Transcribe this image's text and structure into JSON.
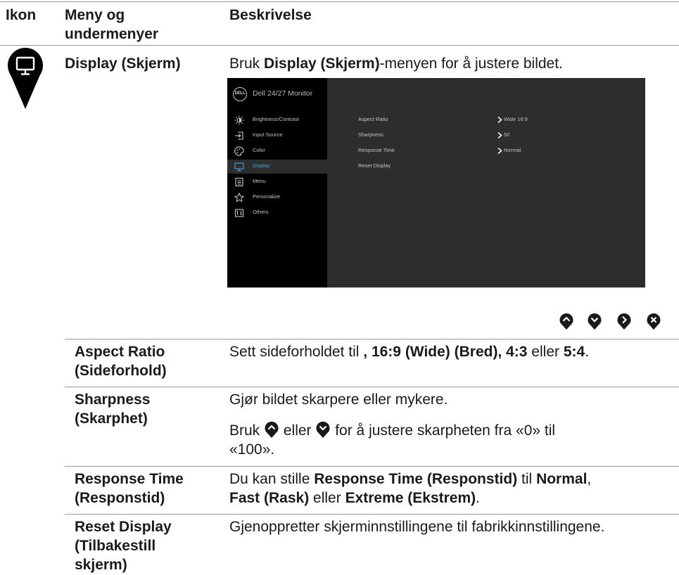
{
  "header": {
    "col_icon": "Ikon",
    "col_menu_line1": "Meny og",
    "col_menu_line2": "undermenyer",
    "col_desc": "Beskrivelse"
  },
  "display_section": {
    "icon": "monitor-icon",
    "menu_label": "Display (Skjerm)",
    "desc_prefix": "Bruk ",
    "desc_bold": "Display (Skjerm)",
    "desc_suffix": "-menyen for å justere bildet."
  },
  "osd": {
    "logo": "DELL",
    "title": "Dell 24/27 Monitor",
    "menu": [
      {
        "icon": "brightness-icon",
        "label": "Brightness/Contrast"
      },
      {
        "icon": "input-source-icon",
        "label": "Input Source"
      },
      {
        "icon": "color-icon",
        "label": "Color"
      },
      {
        "icon": "display-icon",
        "label": "Display",
        "selected": true
      },
      {
        "icon": "menu-icon",
        "label": "Menu"
      },
      {
        "icon": "personalize-star-icon",
        "label": "Personalize"
      },
      {
        "icon": "others-icon",
        "label": "Others"
      }
    ],
    "settings": [
      {
        "label": "Aspect Ratio",
        "value": "Wide 16:9",
        "has_submenu": true
      },
      {
        "label": "Sharpness",
        "value": "50",
        "has_submenu": true
      },
      {
        "label": "Response Time",
        "value": "Normal",
        "has_submenu": true
      },
      {
        "label": "Reset Display",
        "value": "",
        "has_submenu": false
      }
    ],
    "colors": {
      "panel": "#2d2d2d",
      "sidebar": "#000000",
      "accent": "#4aa3e6"
    }
  },
  "nav_buttons": [
    "up-arrow-icon",
    "down-arrow-icon",
    "right-arrow-icon",
    "close-icon"
  ],
  "rows": {
    "aspect": {
      "label_1": "Aspect Ratio",
      "label_2": "(Sideforhold)",
      "d1": "Sett sideforholdet til ",
      "d2": ", 16:9 (Wide) (Bred), 4:3",
      "d3": " eller ",
      "d4": "5:4",
      "d5": "."
    },
    "sharpness": {
      "label_1": "Sharpness",
      "label_2": "(Skarphet)",
      "desc_1": "Gjør bildet skarpere eller mykere.",
      "d2a": "Bruk ",
      "d2b": " eller ",
      "d2c": " for å justere skarpheten fra «0» til",
      "d2d": "«100»."
    },
    "response": {
      "label_1": "Response Time",
      "label_2": "(Responstid)",
      "d1": "Du kan stille ",
      "d2": "Response Time (Responstid)",
      "d3": " til ",
      "d4": "Normal",
      "d5": ",",
      "d6": "Fast (Rask)",
      "d7": " eller ",
      "d8": "Extreme (Ekstrem)",
      "d9": "."
    },
    "reset": {
      "label_1": "Reset Display",
      "label_2": "(Tilbakestill",
      "label_3": "skjerm)",
      "desc": "Gjenoppretter skjerminnstillingene til fabrikkinnstillingene."
    }
  }
}
